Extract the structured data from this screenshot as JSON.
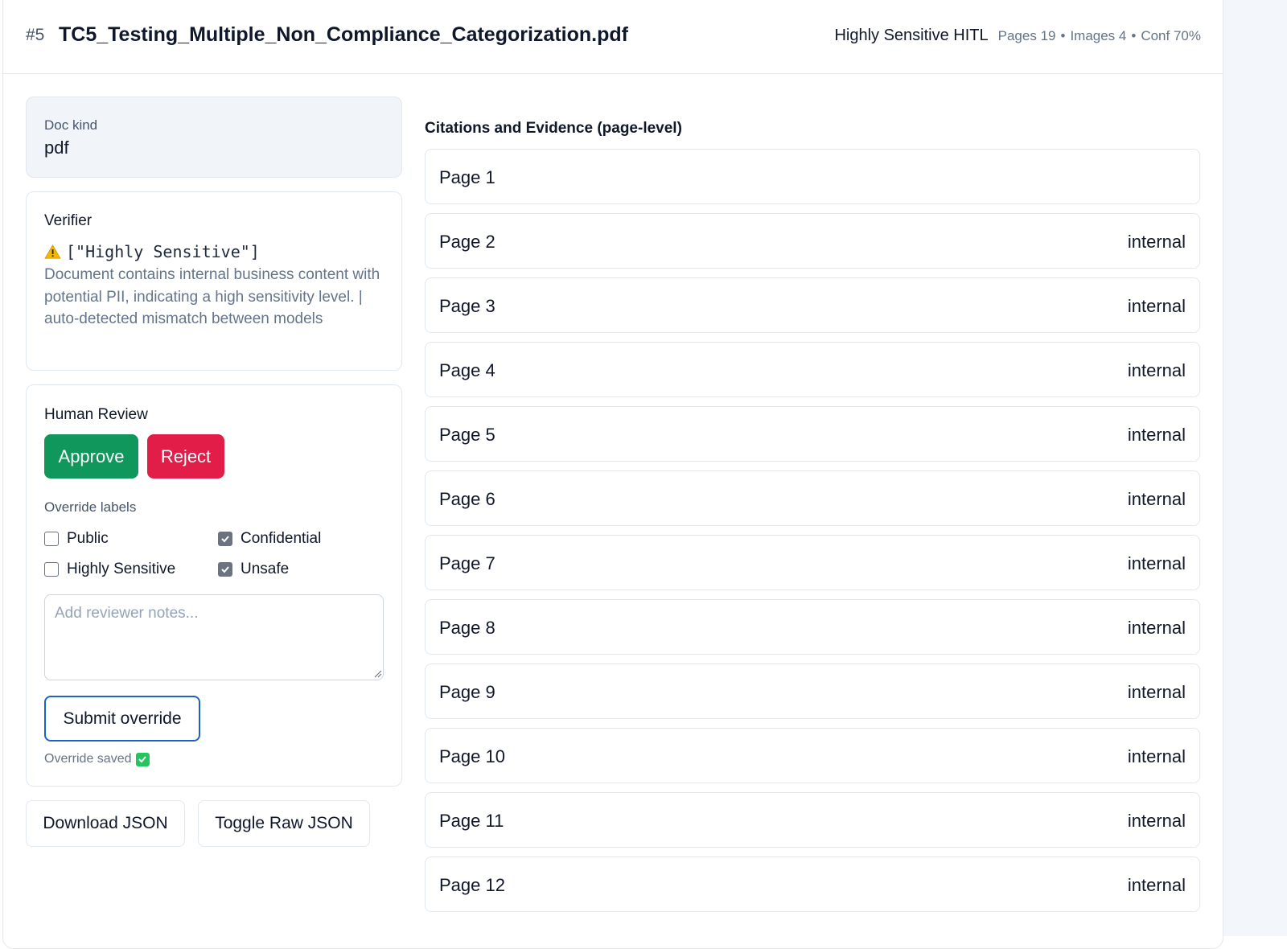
{
  "header": {
    "doc_number": "#5",
    "doc_title": "TC5_Testing_Multiple_Non_Compliance_Categorization.pdf",
    "classification": "Highly Sensitive HITL",
    "pages": "Pages 19",
    "images": "Images 4",
    "conf": "Conf 70%",
    "separator": "•"
  },
  "doc_kind": {
    "label": "Doc kind",
    "value": "pdf"
  },
  "verifier": {
    "title": "Verifier",
    "status_icon": "warning-icon",
    "status_code": "[\"Highly Sensitive\"]",
    "text": "Document contains internal business content with potential PII, indicating a high sensitivity level. | auto-detected mismatch between models"
  },
  "human_review": {
    "title": "Human Review",
    "approve_label": "Approve",
    "reject_label": "Reject",
    "override_label": "Override labels",
    "checkboxes": [
      {
        "label": "Public",
        "checked": false
      },
      {
        "label": "Confidential",
        "checked": true
      },
      {
        "label": "Highly Sensitive",
        "checked": false
      },
      {
        "label": "Unsafe",
        "checked": true
      }
    ],
    "notes_placeholder": "Add reviewer notes...",
    "submit_label": "Submit override",
    "saved_text": "Override saved",
    "saved_icon": "check-mark-icon"
  },
  "actions": {
    "download_label": "Download JSON",
    "toggle_label": "Toggle Raw JSON"
  },
  "citations": {
    "title": "Citations and Evidence (page-level)",
    "pages": [
      {
        "label": "Page 1",
        "tag": ""
      },
      {
        "label": "Page 2",
        "tag": "internal"
      },
      {
        "label": "Page 3",
        "tag": "internal"
      },
      {
        "label": "Page 4",
        "tag": "internal"
      },
      {
        "label": "Page 5",
        "tag": "internal"
      },
      {
        "label": "Page 6",
        "tag": "internal"
      },
      {
        "label": "Page 7",
        "tag": "internal"
      },
      {
        "label": "Page 8",
        "tag": "internal"
      },
      {
        "label": "Page 9",
        "tag": "internal"
      },
      {
        "label": "Page 10",
        "tag": "internal"
      },
      {
        "label": "Page 11",
        "tag": "internal"
      },
      {
        "label": "Page 12",
        "tag": "internal"
      }
    ]
  },
  "colors": {
    "approve": "#10975c",
    "reject": "#e11d48",
    "submit_border": "#1d63c2"
  }
}
